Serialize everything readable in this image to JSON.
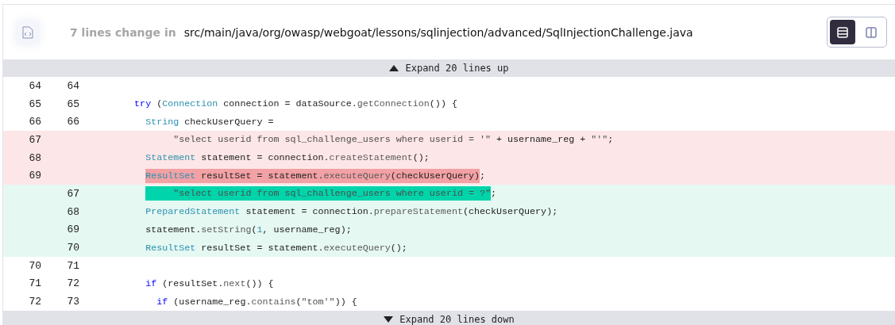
{
  "header": {
    "summary": "7 lines change in",
    "path": "src/main/java/org/owasp/webgoat/lessons/sqlinjection/advanced/SqlInjectionChallenge.java"
  },
  "view_modes": [
    {
      "kind": "unified",
      "selected": true
    },
    {
      "kind": "split",
      "selected": false
    }
  ],
  "expand_up": {
    "label": "Expand 20 lines up"
  },
  "lines": [
    {
      "kind": "context",
      "old": "64",
      "new": "64"
    },
    {
      "kind": "context",
      "old": "65",
      "new": "65",
      "tokens": [
        {
          "text": "        try",
          "kind": "keyword"
        },
        {
          "text": " (",
          "kind": "plain"
        },
        {
          "text": "Connection",
          "kind": "type"
        },
        {
          "text": " connection = dataSource.",
          "kind": "plain"
        },
        {
          "text": "getConnection",
          "kind": "method"
        },
        {
          "text": "()) {",
          "kind": "plain"
        }
      ]
    },
    {
      "kind": "context",
      "old": "66",
      "new": "66",
      "tokens": [
        {
          "text": "          String",
          "kind": "type"
        },
        {
          "text": " checkUserQuery =",
          "kind": "plain"
        }
      ]
    },
    {
      "kind": "removed",
      "old": "67",
      "tokens": [
        {
          "text": "               \"select userid from sql_challenge_users where userid = '\"",
          "kind": "string"
        },
        {
          "text": " + username_reg + ",
          "kind": "plain"
        },
        {
          "text": "\"'\"",
          "kind": "string"
        },
        {
          "text": ";",
          "kind": "plain"
        }
      ]
    },
    {
      "kind": "removed",
      "old": "68",
      "tokens": [
        {
          "text": "          Statement",
          "kind": "type"
        },
        {
          "text": " statement = connection.",
          "kind": "plain"
        },
        {
          "text": "createStatement",
          "kind": "method"
        },
        {
          "text": "();",
          "kind": "plain"
        }
      ]
    },
    {
      "kind": "removed",
      "old": "69",
      "highlight": [
        {
          "text": "          ResultSet",
          "kind": "type"
        },
        {
          "text": " resultSet = statement.",
          "kind": "plain"
        },
        {
          "text": "executeQuery",
          "kind": "method"
        },
        {
          "text": "(checkUserQuery)",
          "kind": "plain"
        }
      ],
      "tokens": [
        {
          "text": ";",
          "kind": "plain"
        }
      ]
    },
    {
      "kind": "added",
      "new": "67",
      "highlight": [
        {
          "text": "               \"select userid from sql_challenge_users where userid = ?\"",
          "kind": "string"
        }
      ],
      "tokens": [
        {
          "text": ";",
          "kind": "plain"
        }
      ]
    },
    {
      "kind": "added",
      "new": "68",
      "tokens": [
        {
          "text": "          PreparedStatement",
          "kind": "type"
        },
        {
          "text": " statement = connection.",
          "kind": "plain"
        },
        {
          "text": "prepareStatement",
          "kind": "method"
        },
        {
          "text": "(checkUserQuery);",
          "kind": "plain"
        }
      ]
    },
    {
      "kind": "added",
      "new": "69",
      "tokens": [
        {
          "text": "          statement.",
          "kind": "plain"
        },
        {
          "text": "setString",
          "kind": "method"
        },
        {
          "text": "(",
          "kind": "plain"
        },
        {
          "text": "1",
          "kind": "number"
        },
        {
          "text": ", username_reg);",
          "kind": "plain"
        }
      ]
    },
    {
      "kind": "added",
      "new": "70",
      "tokens": [
        {
          "text": "          ResultSet",
          "kind": "type"
        },
        {
          "text": " resultSet = statement.",
          "kind": "plain"
        },
        {
          "text": "executeQuery",
          "kind": "method"
        },
        {
          "text": "();",
          "kind": "plain"
        }
      ]
    },
    {
      "kind": "context",
      "old": "70",
      "new": "71"
    },
    {
      "kind": "context",
      "old": "71",
      "new": "72",
      "tokens": [
        {
          "text": "          if",
          "kind": "keyword"
        },
        {
          "text": " (resultSet.",
          "kind": "plain"
        },
        {
          "text": "next",
          "kind": "method"
        },
        {
          "text": "()) {",
          "kind": "plain"
        }
      ]
    },
    {
      "kind": "context",
      "old": "72",
      "new": "73",
      "tokens": [
        {
          "text": "            if",
          "kind": "keyword"
        },
        {
          "text": " (username_reg.",
          "kind": "plain"
        },
        {
          "text": "contains",
          "kind": "method"
        },
        {
          "text": "(",
          "kind": "plain"
        },
        {
          "text": "\"tom'\"",
          "kind": "string"
        },
        {
          "text": ")) {",
          "kind": "plain"
        }
      ]
    }
  ],
  "expand_down": {
    "label": "Expand 20 lines down"
  }
}
